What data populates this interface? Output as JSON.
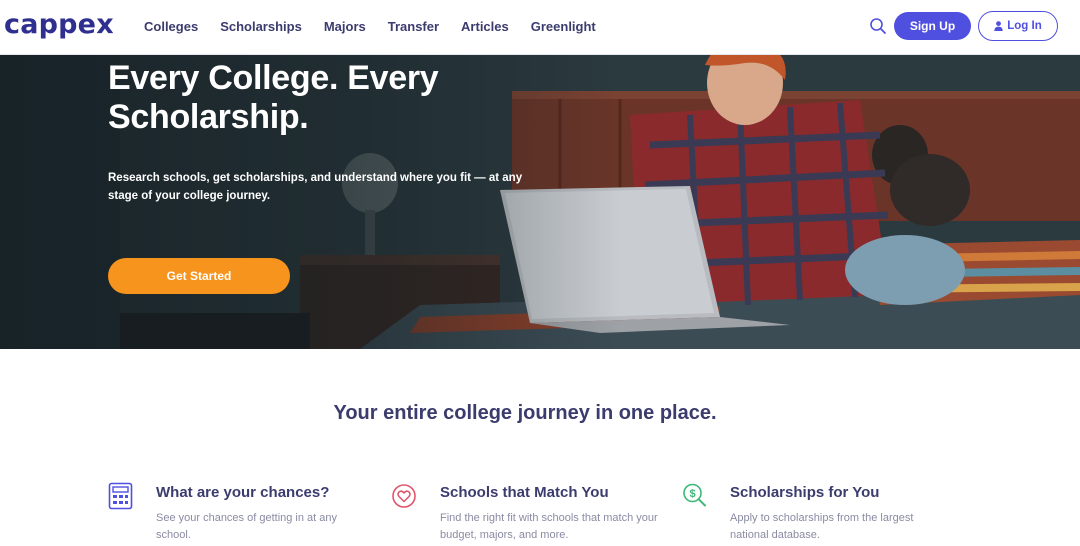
{
  "brand": {
    "logo": "cappex"
  },
  "nav": {
    "links": [
      "Colleges",
      "Scholarships",
      "Majors",
      "Transfer",
      "Articles",
      "Greenlight"
    ],
    "search_icon": "search-icon",
    "signup_label": "Sign Up",
    "login_label": "Log In"
  },
  "hero": {
    "title": "Every College. Every Scholarship.",
    "subtitle": "Research schools, get scholarships, and understand where you fit — at any stage of your college journey.",
    "cta_label": "Get Started"
  },
  "section": {
    "title": "Your entire college journey in one place.",
    "features": [
      {
        "icon": "calculator-icon",
        "title": "What are your chances?",
        "desc": "See your chances of getting in at any school."
      },
      {
        "icon": "heart-icon",
        "title": "Schools that Match You",
        "desc": "Find the right fit with schools that match your budget, majors, and more."
      },
      {
        "icon": "dollar-search-icon",
        "title": "Scholarships for You",
        "desc": "Apply to scholarships from the largest national database."
      }
    ]
  },
  "colors": {
    "brand": "#2f2f8f",
    "primary": "#5050e0",
    "cta": "#f7941d",
    "heading": "#3b3c6e",
    "muted": "#8a8ba3",
    "heart_icon": "#e0546b",
    "scholarship_icon": "#3cb878"
  }
}
